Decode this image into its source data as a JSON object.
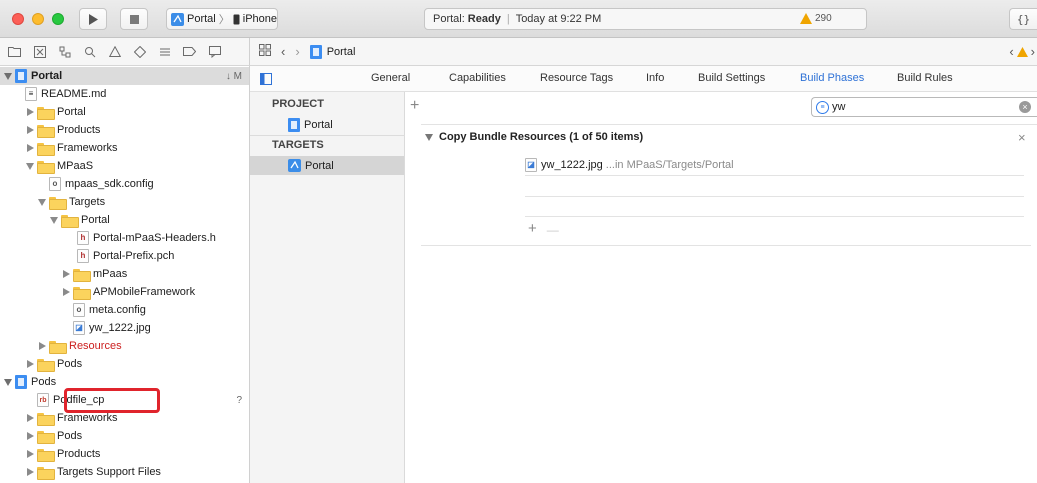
{
  "toolbar": {
    "scheme": {
      "target": "Portal",
      "device": "iPhone"
    },
    "status": {
      "prefix": "Portal:",
      "state": "Ready",
      "time": "Today at 9:22 PM"
    },
    "warnings": "290",
    "right_button": "{}"
  },
  "navigator": {
    "rows": [
      {
        "label": "Portal",
        "trailing": "↓ M"
      },
      {
        "label": "README.md"
      },
      {
        "label": "Portal"
      },
      {
        "label": "Products"
      },
      {
        "label": "Frameworks"
      },
      {
        "label": "MPaaS"
      },
      {
        "label": "mpaas_sdk.config"
      },
      {
        "label": "Targets"
      },
      {
        "label": "Portal"
      },
      {
        "label": "Portal-mPaaS-Headers.h"
      },
      {
        "label": "Portal-Prefix.pch"
      },
      {
        "label": "mPaas"
      },
      {
        "label": "APMobileFramework"
      },
      {
        "label": "meta.config"
      },
      {
        "label": "yw_1222.jpg"
      },
      {
        "label": "Resources"
      },
      {
        "label": "Pods"
      },
      {
        "label": "Pods"
      },
      {
        "label": "Podfile_cp",
        "trailing": "?"
      },
      {
        "label": "Frameworks"
      },
      {
        "label": "Pods"
      },
      {
        "label": "Products"
      },
      {
        "label": "Targets Support Files"
      }
    ]
  },
  "jump_bar": {
    "file": "Portal"
  },
  "tabs": [
    "General",
    "Capabilities",
    "Resource Tags",
    "Info",
    "Build Settings",
    "Build Phases",
    "Build Rules"
  ],
  "targets_pane": {
    "project_header": "PROJECT",
    "project_item": "Portal",
    "targets_header": "TARGETS",
    "target_item": "Portal"
  },
  "phases": {
    "add": "+",
    "filter_value": "yw",
    "section_title": "Copy Bundle Resources (1 of 50 items)",
    "close": "×",
    "resource_name": "yw_1222.jpg",
    "resource_path": "...in MPaaS/Targets/Portal",
    "add_button": "+",
    "remove_button": "—"
  },
  "colors": {
    "accent": "#2f72d6",
    "highlight": "#e0242c",
    "warning": "#f0a500",
    "red_text": "#cc2020"
  }
}
